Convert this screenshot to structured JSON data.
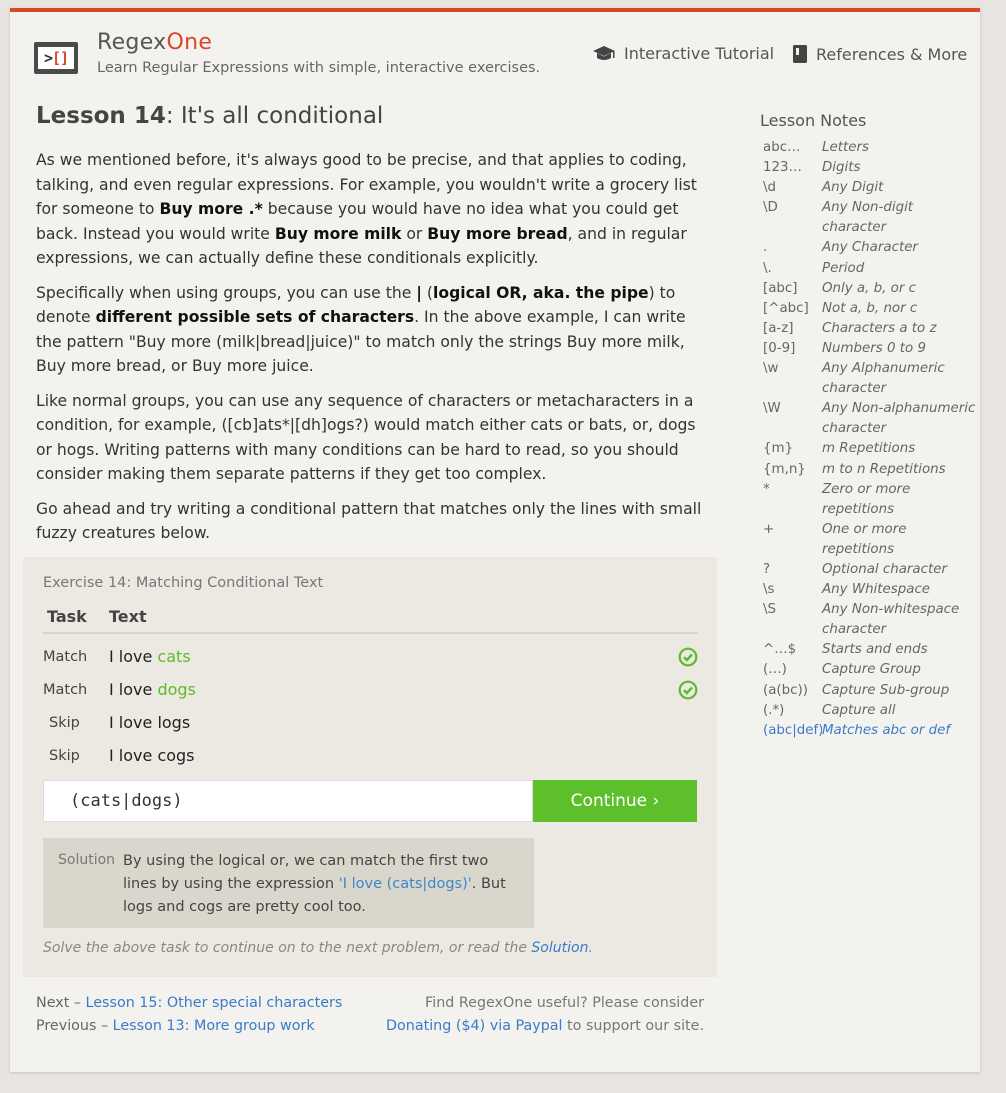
{
  "colors": {
    "accent": "#d9472b",
    "success": "#5dc02a",
    "link": "#3a7bc8"
  },
  "header": {
    "brand_main": "Regex",
    "brand_accent": "One",
    "tagline": "Learn Regular Expressions with simple, interactive exercises.",
    "nav": [
      {
        "label": "Interactive Tutorial",
        "icon": "graduation-cap-icon"
      },
      {
        "label": "References & More",
        "icon": "book-icon"
      }
    ]
  },
  "lesson": {
    "title_prefix": "Lesson 14",
    "title_rest": ": It's all conditional",
    "p1_a": "As we mentioned before, it's always good to be precise, and that applies to coding, talking, and even regular expressions. For example, you wouldn't write a grocery list for someone to ",
    "p1_b": "Buy more .*",
    "p1_c": " because you would have no idea what you could get back. Instead you would write ",
    "p1_d": "Buy more milk",
    "p1_e": " or ",
    "p1_f": "Buy more bread",
    "p1_g": ", and in regular expressions, we can actually define these conditionals explicitly.",
    "p2_a": "Specifically when using groups, you can use the ",
    "p2_b": "|",
    "p2_c": " (",
    "p2_d": "logical OR, aka. the pipe",
    "p2_e": ") to denote ",
    "p2_f": "different possible sets of characters",
    "p2_g": ". In the above example, I can write the pattern \"Buy more (milk|bread|juice)\" to match only the strings Buy more milk, Buy more bread, or Buy more juice.",
    "p3": "Like normal groups, you can use any sequence of characters or metacharacters in a condition, for example, ([cb]ats*|[dh]ogs?) would match either cats or bats, or, dogs or hogs. Writing patterns with many conditions can be hard to read, so you should consider making them separate patterns if they get too complex.",
    "p4": "Go ahead and try writing a conditional pattern that matches only the lines with small fuzzy creatures below."
  },
  "exercise": {
    "title": "Exercise 14: Matching Conditional Text",
    "col_task": "Task",
    "col_text": "Text",
    "rows": [
      {
        "task": "Match",
        "prefix": "I love ",
        "match": "cats",
        "rest": "",
        "status": "success"
      },
      {
        "task": "Match",
        "prefix": "I love ",
        "match": "dogs",
        "rest": "",
        "status": "success"
      },
      {
        "task": "Skip",
        "prefix": "I love logs",
        "match": "",
        "rest": "",
        "status": ""
      },
      {
        "task": "Skip",
        "prefix": "I love cogs",
        "match": "",
        "rest": "",
        "status": ""
      }
    ],
    "input_value": "(cats|dogs)",
    "continue_label": "Continue ›",
    "solution_label": "Solution",
    "solution_a": "By using the logical or, we can match the first two lines by using the expression ",
    "solution_code": "'I love (cats|dogs)'",
    "solution_b": ". But logs and cogs are pretty cool too.",
    "footer_a": "Solve the above task to continue on to the next problem, or read the ",
    "footer_link": "Solution",
    "footer_b": "."
  },
  "bottom": {
    "next_prefix": "Next – ",
    "next_link": "Lesson 15: Other special characters",
    "prev_prefix": "Previous – ",
    "prev_link": "Lesson 13: More group work",
    "donate_line1": "Find RegexOne useful? Please consider",
    "donate_link": "Donating ($4) via Paypal",
    "donate_rest": " to support our site."
  },
  "notes": {
    "title": "Lesson Notes",
    "items": [
      {
        "k": "abc…",
        "v": "Letters"
      },
      {
        "k": "123…",
        "v": "Digits"
      },
      {
        "k": "\\d",
        "v": "Any Digit"
      },
      {
        "k": "\\D",
        "v": "Any Non-digit character"
      },
      {
        "k": ".",
        "v": "Any Character"
      },
      {
        "k": "\\.",
        "v": "Period"
      },
      {
        "k": "[abc]",
        "v": "Only a, b, or c"
      },
      {
        "k": "[^abc]",
        "v": "Not a, b, nor c"
      },
      {
        "k": "[a-z]",
        "v": "Characters a to z"
      },
      {
        "k": "[0-9]",
        "v": "Numbers 0 to 9"
      },
      {
        "k": "\\w",
        "v": "Any Alphanumeric character"
      },
      {
        "k": "\\W",
        "v": "Any Non-alphanumeric character"
      },
      {
        "k": "{m}",
        "v": "m Repetitions"
      },
      {
        "k": "{m,n}",
        "v": "m to n Repetitions"
      },
      {
        "k": "*",
        "v": "Zero or more repetitions"
      },
      {
        "k": "+",
        "v": "One or more repetitions"
      },
      {
        "k": "?",
        "v": "Optional character"
      },
      {
        "k": "\\s",
        "v": "Any Whitespace"
      },
      {
        "k": "\\S",
        "v": "Any Non-whitespace character"
      },
      {
        "k": "^…$",
        "v": "Starts and ends"
      },
      {
        "k": "(…)",
        "v": "Capture Group"
      },
      {
        "k": "(a(bc))",
        "v": "Capture Sub-group"
      },
      {
        "k": "(.*)",
        "v": "Capture all"
      },
      {
        "k": "(abc|def)",
        "v": "Matches abc or def",
        "highlight": true
      }
    ]
  }
}
